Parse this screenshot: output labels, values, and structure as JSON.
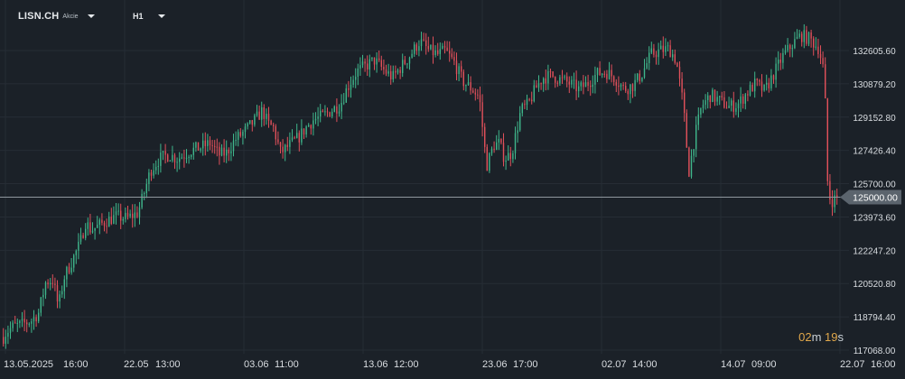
{
  "header": {
    "symbol": "LISN.CH",
    "asset_type": "Akcie",
    "timeframe": "H1"
  },
  "countdown": {
    "minutes": "02",
    "minutes_unit": "m",
    "seconds": "19",
    "seconds_unit": "s"
  },
  "colors": {
    "background": "#1b2128",
    "up": "#3fb68b",
    "down": "#e0505a",
    "grid": "#262d35",
    "price_line": "#8f979e",
    "axis_text": "#d9dde1",
    "countdown": "#e0a74a"
  },
  "chart_data": {
    "type": "candlestick",
    "symbol": "LISN.CH",
    "timeframe": "H1",
    "current_price": 125000.0,
    "current_price_label": "125000.00",
    "ylim": [
      117000,
      134500
    ],
    "y_ticks": [
      132605.6,
      130879.2,
      129152.8,
      127426.4,
      125700.0,
      123973.6,
      122247.2,
      120520.8,
      118794.4,
      117068.0
    ],
    "y_tick_labels": [
      "132605.60",
      "130879.20",
      "129152.80",
      "127426.40",
      "125700.00",
      "123973.60",
      "122247.20",
      "120520.80",
      "118794.40",
      "117068.00"
    ],
    "x_tick_labels": [
      "13.05.2025",
      "16:00",
      "22.05",
      "13:00",
      "03.06",
      "11:00",
      "13.06",
      "12:00",
      "23.06",
      "17:00",
      "02.07",
      "14:00",
      "14.07",
      "09:00",
      "22.07",
      "16:00"
    ],
    "close_path": [
      [
        0,
        117500
      ],
      [
        6,
        118000
      ],
      [
        14,
        118300
      ],
      [
        24,
        118400
      ],
      [
        34,
        118600
      ],
      [
        42,
        119000
      ],
      [
        50,
        120600
      ],
      [
        58,
        120700
      ],
      [
        64,
        119300
      ],
      [
        70,
        120800
      ],
      [
        80,
        121800
      ],
      [
        88,
        122600
      ],
      [
        94,
        123700
      ],
      [
        100,
        123300
      ],
      [
        108,
        123500
      ],
      [
        118,
        123800
      ],
      [
        128,
        124000
      ],
      [
        140,
        123900
      ],
      [
        152,
        124200
      ],
      [
        160,
        125400
      ],
      [
        166,
        126400
      ],
      [
        176,
        127000
      ],
      [
        186,
        127200
      ],
      [
        196,
        127000
      ],
      [
        210,
        127400
      ],
      [
        222,
        127600
      ],
      [
        232,
        127800
      ],
      [
        242,
        127200
      ],
      [
        250,
        127300
      ],
      [
        260,
        128000
      ],
      [
        270,
        128400
      ],
      [
        280,
        128900
      ],
      [
        290,
        129500
      ],
      [
        296,
        128800
      ],
      [
        302,
        128600
      ],
      [
        310,
        127300
      ],
      [
        320,
        127700
      ],
      [
        330,
        128100
      ],
      [
        338,
        128600
      ],
      [
        346,
        129000
      ],
      [
        356,
        129200
      ],
      [
        366,
        129500
      ],
      [
        376,
        129800
      ],
      [
        384,
        130700
      ],
      [
        394,
        131500
      ],
      [
        404,
        131800
      ],
      [
        414,
        132100
      ],
      [
        424,
        131600
      ],
      [
        434,
        131200
      ],
      [
        444,
        131800
      ],
      [
        454,
        132400
      ],
      [
        464,
        133100
      ],
      [
        474,
        132600
      ],
      [
        484,
        132400
      ],
      [
        492,
        132600
      ],
      [
        502,
        132000
      ],
      [
        512,
        131000
      ],
      [
        522,
        130600
      ],
      [
        530,
        130200
      ],
      [
        538,
        126600
      ],
      [
        546,
        127700
      ],
      [
        552,
        127800
      ],
      [
        558,
        127000
      ],
      [
        566,
        127300
      ],
      [
        576,
        129500
      ],
      [
        584,
        129800
      ],
      [
        592,
        130600
      ],
      [
        600,
        131200
      ],
      [
        610,
        131300
      ],
      [
        620,
        131100
      ],
      [
        630,
        130900
      ],
      [
        640,
        130600
      ],
      [
        650,
        130900
      ],
      [
        660,
        131400
      ],
      [
        670,
        131500
      ],
      [
        680,
        131200
      ],
      [
        690,
        130600
      ],
      [
        700,
        130800
      ],
      [
        710,
        131400
      ],
      [
        720,
        132400
      ],
      [
        730,
        132600
      ],
      [
        740,
        132700
      ],
      [
        748,
        132100
      ],
      [
        756,
        129700
      ],
      [
        762,
        126300
      ],
      [
        768,
        128000
      ],
      [
        776,
        129700
      ],
      [
        786,
        130300
      ],
      [
        796,
        130000
      ],
      [
        806,
        129700
      ],
      [
        816,
        129800
      ],
      [
        826,
        130400
      ],
      [
        836,
        130900
      ],
      [
        846,
        130500
      ],
      [
        856,
        131400
      ],
      [
        866,
        132300
      ],
      [
        876,
        132900
      ],
      [
        886,
        133400
      ],
      [
        896,
        133200
      ],
      [
        906,
        132700
      ],
      [
        912,
        131400
      ],
      [
        916,
        125200
      ],
      [
        920,
        124800
      ],
      [
        926,
        125000
      ]
    ],
    "wick_scale": 0.22
  }
}
